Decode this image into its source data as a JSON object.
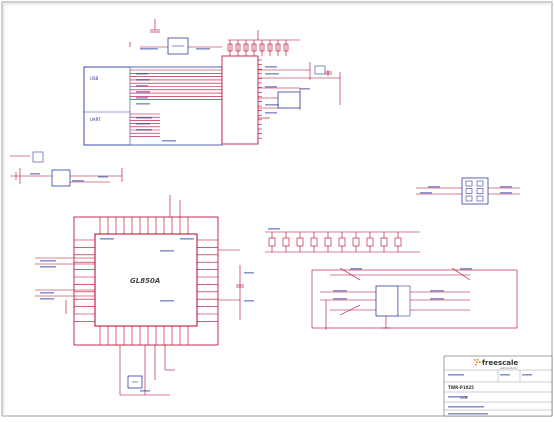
{
  "schematic": {
    "chip_main_label": "GL850A",
    "block_usb_label": "USB",
    "block_uart_label": "UART",
    "title_block": {
      "brand": "freescale",
      "brand_sub": "semiconductor",
      "board": "TWR-P1025",
      "sheet_title": "USB"
    }
  },
  "colors": {
    "wire": "#b5002a",
    "wire_blue": "#2d3fa8",
    "frame": "#888888",
    "text_blue": "#1f2e99",
    "text_dark": "#444444",
    "brand_orange": "#f08a00"
  }
}
